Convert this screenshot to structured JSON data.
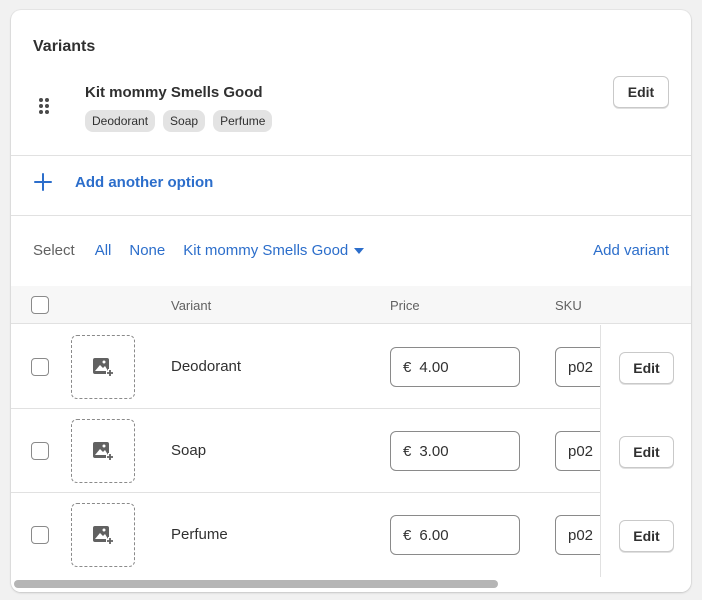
{
  "section": {
    "title": "Variants"
  },
  "option": {
    "name": "Kit mommy Smells Good",
    "values": [
      "Deodorant",
      "Soap",
      "Perfume"
    ],
    "edit_label": "Edit"
  },
  "add_option": {
    "label": "Add another option"
  },
  "select_bar": {
    "label": "Select",
    "all": "All",
    "none": "None",
    "filter": "Kit mommy Smells Good",
    "add_variant": "Add variant"
  },
  "table": {
    "headers": {
      "variant": "Variant",
      "price": "Price",
      "sku": "SKU"
    },
    "rows": [
      {
        "name": "Deodorant",
        "currency": "€",
        "price": "4.00",
        "sku": "p02",
        "edit": "Edit"
      },
      {
        "name": "Soap",
        "currency": "€",
        "price": "3.00",
        "sku": "p02",
        "edit": "Edit"
      },
      {
        "name": "Perfume",
        "currency": "€",
        "price": "6.00",
        "sku": "p02",
        "edit": "Edit"
      }
    ]
  },
  "colors": {
    "accent": "#2c6ecb",
    "text": "#303030",
    "muted": "#616161",
    "chip": "#e3e3e3"
  }
}
